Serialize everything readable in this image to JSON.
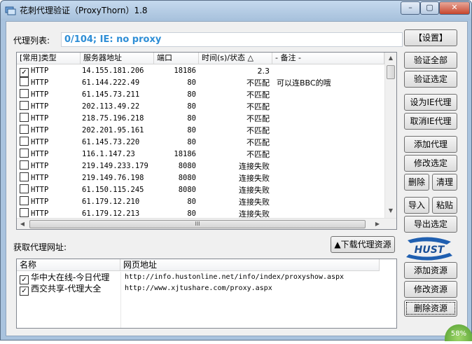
{
  "window": {
    "title": "花刺代理验证（ProxyThorn）1.8",
    "minimize_label": "–",
    "maximize_label": "▢",
    "close_label": "✕"
  },
  "proxy_list": {
    "label": "代理列表:",
    "status": "0/104;   IE: no proxy",
    "columns": [
      "[常用]类型",
      "服务器地址",
      "端口",
      "时间(s)/状态 △",
      "- 备注 -"
    ],
    "rows": [
      {
        "checked": true,
        "type": "HTTP",
        "address": "14.155.181.206",
        "port": "18186",
        "status": "2.3",
        "note": ""
      },
      {
        "checked": false,
        "type": "HTTP",
        "address": "61.144.222.49",
        "port": "80",
        "status": "不匹配",
        "note": "可以连BBC的哦"
      },
      {
        "checked": false,
        "type": "HTTP",
        "address": "61.145.73.211",
        "port": "80",
        "status": "不匹配",
        "note": ""
      },
      {
        "checked": false,
        "type": "HTTP",
        "address": "202.113.49.22",
        "port": "80",
        "status": "不匹配",
        "note": ""
      },
      {
        "checked": false,
        "type": "HTTP",
        "address": "218.75.196.218",
        "port": "80",
        "status": "不匹配",
        "note": ""
      },
      {
        "checked": false,
        "type": "HTTP",
        "address": "202.201.95.161",
        "port": "80",
        "status": "不匹配",
        "note": ""
      },
      {
        "checked": false,
        "type": "HTTP",
        "address": "61.145.73.220",
        "port": "80",
        "status": "不匹配",
        "note": ""
      },
      {
        "checked": false,
        "type": "HTTP",
        "address": "116.1.147.23",
        "port": "18186",
        "status": "不匹配",
        "note": ""
      },
      {
        "checked": false,
        "type": "HTTP",
        "address": "219.149.233.179",
        "port": "8080",
        "status": "连接失败",
        "note": ""
      },
      {
        "checked": false,
        "type": "HTTP",
        "address": "219.149.76.198",
        "port": "8080",
        "status": "连接失败",
        "note": ""
      },
      {
        "checked": false,
        "type": "HTTP",
        "address": "61.150.115.245",
        "port": "8080",
        "status": "连接失败",
        "note": ""
      },
      {
        "checked": false,
        "type": "HTTP",
        "address": "61.179.12.210",
        "port": "80",
        "status": "连接失败",
        "note": ""
      },
      {
        "checked": false,
        "type": "HTTP",
        "address": "61.179.12.213",
        "port": "80",
        "status": "连接失败",
        "note": ""
      }
    ]
  },
  "buttons": {
    "settings": "【设置】",
    "verify_all": "验证全部",
    "verify_selected": "验证选定",
    "set_ie_proxy": "设为IE代理",
    "cancel_ie_proxy": "取消IE代理",
    "add_proxy": "添加代理",
    "edit_selected": "修改选定",
    "delete": "删除",
    "clean": "清理",
    "import": "导入",
    "paste": "粘贴",
    "export_selected": "导出选定",
    "download_sources": "▲下载代理资源",
    "add_source": "添加资源",
    "edit_source": "修改资源",
    "delete_source": "删除资源"
  },
  "sources": {
    "label": "获取代理网址:",
    "columns": [
      "名称",
      "网页地址"
    ],
    "rows": [
      {
        "checked": true,
        "name": "华中大在线-今日代理",
        "url": "http://info.hustonline.net/info/index/proxyshow.aspx"
      },
      {
        "checked": true,
        "name": "西交共享-代理大全",
        "url": "http://www.xjtushare.com/proxy.aspx"
      }
    ]
  },
  "logo_text": "HUST",
  "scroll_grip": "III",
  "badge": "58%",
  "colors": {
    "status_text": "#2e8ed6",
    "titlebar": "#a9c3de",
    "badge": "#6cb33f"
  }
}
